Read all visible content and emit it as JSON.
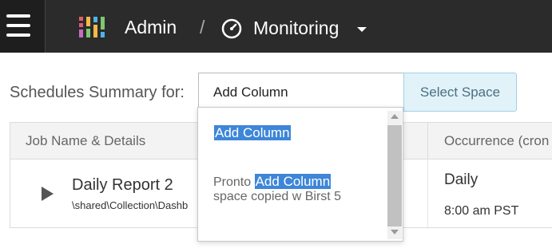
{
  "header": {
    "app_title": "Admin",
    "separator": "/",
    "section_title": "Monitoring",
    "icons": {
      "menu": "hamburger-menu-icon",
      "app": "app-grid-icon",
      "section": "clock-gauge-icon",
      "caret": "chevron-down-icon"
    },
    "colors": {
      "bar": "#2b2b2b",
      "menu_bg": "#1e1e1e"
    }
  },
  "summary": {
    "label": "Schedules Summary for:",
    "search_value": "Add Column",
    "select_space_label": "Select Space"
  },
  "autocomplete": {
    "options": [
      {
        "text": "Add Column"
      },
      {
        "prefix": "Pronto ",
        "match": "Add Column",
        "suffix": "space copied w Birst 5"
      }
    ],
    "highlight_color": "#3d86d8"
  },
  "table": {
    "columns": [
      "Job Name & Details",
      "Occurrence (cron"
    ],
    "rows": [
      {
        "name": "Daily Report 2",
        "path": "\\shared\\Collection\\Dashb",
        "occurrence": "Daily",
        "time": "8:00 am PST"
      }
    ]
  }
}
